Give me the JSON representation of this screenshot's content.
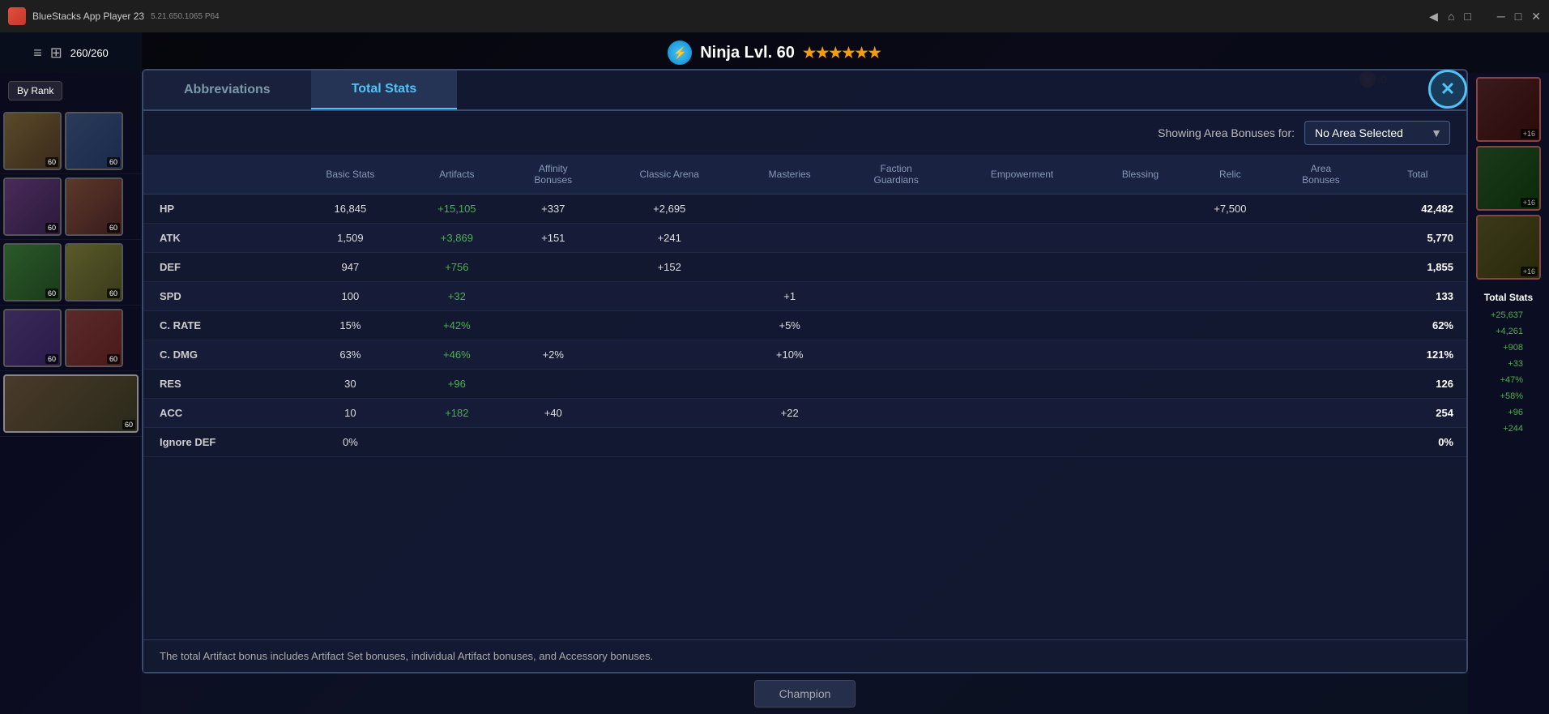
{
  "app": {
    "title": "BlueStacks App Player 23",
    "version": "5.21.650.1065  P64",
    "coin_count": "0"
  },
  "game_header": {
    "title": "Ninja Lvl. 60",
    "stars": "★★★★★★",
    "steps": "260/260"
  },
  "tabs": {
    "abbreviations": "Abbreviations",
    "total_stats": "Total Stats",
    "active": "total_stats"
  },
  "close_button": "✕",
  "area_bonus": {
    "label": "Showing Area Bonuses for:",
    "selected": "No Area Selected"
  },
  "table": {
    "headers": [
      "",
      "Basic Stats",
      "Artifacts",
      "Affinity Bonuses",
      "Classic Arena",
      "Masteries",
      "Faction Guardians",
      "Empowerment",
      "Blessing",
      "Relic",
      "Area Bonuses",
      "Total"
    ],
    "rows": [
      {
        "stat": "HP",
        "basic": "16,845",
        "artifacts": "+15,105",
        "affinity": "+337",
        "classic": "+2,695",
        "masteries": "",
        "faction": "",
        "empowerment": "",
        "blessing": "",
        "relic": "+7,500",
        "area": "",
        "total": "42,482"
      },
      {
        "stat": "ATK",
        "basic": "1,509",
        "artifacts": "+3,869",
        "affinity": "+151",
        "classic": "+241",
        "masteries": "",
        "faction": "",
        "empowerment": "",
        "blessing": "",
        "relic": "",
        "area": "",
        "total": "5,770"
      },
      {
        "stat": "DEF",
        "basic": "947",
        "artifacts": "+756",
        "affinity": "",
        "classic": "+152",
        "masteries": "",
        "faction": "",
        "empowerment": "",
        "blessing": "",
        "relic": "",
        "area": "",
        "total": "1,855"
      },
      {
        "stat": "SPD",
        "basic": "100",
        "artifacts": "+32",
        "affinity": "",
        "classic": "",
        "masteries": "+1",
        "faction": "",
        "empowerment": "",
        "blessing": "",
        "relic": "",
        "area": "",
        "total": "133"
      },
      {
        "stat": "C. RATE",
        "basic": "15%",
        "artifacts": "+42%",
        "affinity": "",
        "classic": "",
        "masteries": "+5%",
        "faction": "",
        "empowerment": "",
        "blessing": "",
        "relic": "",
        "area": "",
        "total": "62%"
      },
      {
        "stat": "C. DMG",
        "basic": "63%",
        "artifacts": "+46%",
        "affinity": "+2%",
        "classic": "",
        "masteries": "+10%",
        "faction": "",
        "empowerment": "",
        "blessing": "",
        "relic": "",
        "area": "",
        "total": "121%"
      },
      {
        "stat": "RES",
        "basic": "30",
        "artifacts": "+96",
        "affinity": "",
        "classic": "",
        "masteries": "",
        "faction": "",
        "empowerment": "",
        "blessing": "",
        "relic": "",
        "area": "",
        "total": "126"
      },
      {
        "stat": "ACC",
        "basic": "10",
        "artifacts": "+182",
        "affinity": "+40",
        "classic": "",
        "masteries": "+22",
        "faction": "",
        "empowerment": "",
        "blessing": "",
        "relic": "",
        "area": "",
        "total": "254"
      },
      {
        "stat": "Ignore DEF",
        "basic": "0%",
        "artifacts": "",
        "affinity": "",
        "classic": "",
        "masteries": "",
        "faction": "",
        "empowerment": "",
        "blessing": "",
        "relic": "",
        "area": "",
        "total": "0%"
      }
    ]
  },
  "footer_note": "The total Artifact bonus includes Artifact Set bonuses, individual Artifact bonuses, and Accessory bonuses.",
  "sidebar": {
    "by_rank": "By Rank",
    "champion_btn": "Champion"
  },
  "right_sidebar_stats": {
    "label": "Total Stats",
    "values": [
      "+25,637",
      "+4,261",
      "+908",
      "+33",
      "+47%",
      "+58%",
      "+96",
      "+244"
    ]
  }
}
